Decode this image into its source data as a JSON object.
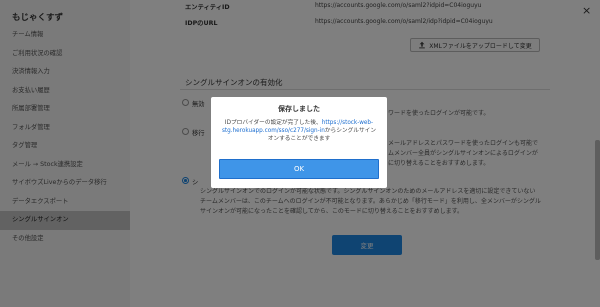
{
  "sidebar": {
    "brand": "もじゃくすず",
    "items": [
      {
        "label": "チーム情報"
      },
      {
        "label": "ご利用状況の確認"
      },
      {
        "label": "決済情報入力"
      },
      {
        "label": "お支払い履歴"
      },
      {
        "label": "所属部署管理"
      },
      {
        "label": "フォルダ管理"
      },
      {
        "label": "タグ管理"
      },
      {
        "label": "メール → Stock連携設定"
      },
      {
        "label": "サイボウズLiveからのデータ移行"
      },
      {
        "label": "データエクスポート"
      },
      {
        "label": "シングルサインオン",
        "active": true
      },
      {
        "label": "その他設定"
      }
    ]
  },
  "main": {
    "entity_label": "エンティティID",
    "entity_value": "https://accounts.google.com/o/saml2?idpid=C04ioguyu",
    "idp_label": "IDPのURL",
    "idp_value": "https://accounts.google.com/o/saml2/idp?idpid=C04ioguyu",
    "upload_label": "XMLファイルをアップロードして変更",
    "section_title": "シングルサインオンの有効化",
    "option1_label": "無効",
    "option1_tail": "ワードを使ったログインが可能です。",
    "option2_label": "移行",
    "option2_tail1": "メールアドレスとパスワードを使ったログインも可能で",
    "option2_tail2": "ムメンバー全員がシングルサインオンによるログインが",
    "option2_tail3": "に切り替えることをおすすめします。",
    "option3_label": "シ",
    "option3_desc1": "シングルサインオンでのログインが可能な状態です。シングルサインオンのためのメールアドレスを適切に設定できていない",
    "option3_desc2": "チームメンバーは、このチームへのログインが不可能となります。あらかじめ「移行モード」を利用し、全メンバーがシングル",
    "option3_desc3": "サインオンが可能になったことを確認してから、このモードに切り替えることをおすすめします。",
    "change_label": "変更",
    "close_glyph": "×"
  },
  "modal": {
    "title": "保存しました",
    "msg_line1_prefix": "IDプロバイダーの設定が完了した後、",
    "msg_line1_link": "https://stock-web-",
    "msg_line2_link": "stg.herokuapp.com/sso/c277/sign-in",
    "msg_line2_suffix": "からシングルサイン",
    "msg_line3": "オンすることができます",
    "ok_label": "OK"
  },
  "colors": {
    "primary": "#1e88e5",
    "link": "#1e6fd0",
    "overlay": "rgba(0,0,0,0.5)"
  },
  "icons": {
    "upload": "upload-icon",
    "close": "close-icon"
  }
}
